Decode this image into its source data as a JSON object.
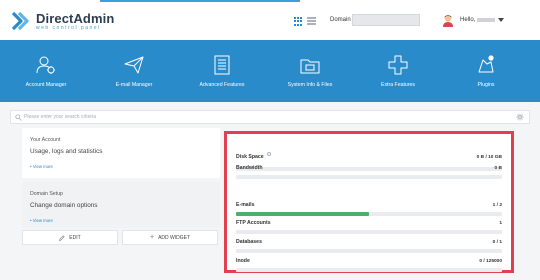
{
  "brand": {
    "title": "DirectAdmin",
    "subtitle": "web control panel",
    "colors": {
      "primary": "#2a8bcb",
      "dark": "#2c3e50",
      "highlight": "#e0414e",
      "progress": "#4caf6a"
    }
  },
  "header": {
    "domain_label": "Domain",
    "hello_label": "Hello,"
  },
  "nav": {
    "items": [
      {
        "label": "Account Manager",
        "icon": "account-manager-icon"
      },
      {
        "label": "E-mail Manager",
        "icon": "email-manager-icon"
      },
      {
        "label": "Advanced Features",
        "icon": "advanced-features-icon"
      },
      {
        "label": "System Info & Files",
        "icon": "system-info-icon"
      },
      {
        "label": "Extra Features",
        "icon": "extra-features-icon"
      },
      {
        "label": "Plugins",
        "icon": "plugins-icon"
      }
    ]
  },
  "search": {
    "placeholder": "Please enter your search criteria"
  },
  "cards": [
    {
      "title": "Your Account",
      "desc": "Usage, logs and statistics",
      "link": "• View more"
    },
    {
      "title": "Domain Setup",
      "desc": "Change domain options",
      "link": "• View more"
    }
  ],
  "actions": {
    "edit_label": "EDIT",
    "add_widget_label": "ADD WIDGET"
  },
  "stats": [
    {
      "label": "Disk Space",
      "value": "0 B / 10 GB",
      "fraction": 0.0,
      "info": true
    },
    {
      "label": "Bandwidth",
      "value": "0 B",
      "fraction": 0.0,
      "info": false
    },
    {
      "label": "E-mails",
      "value": "1 / 2",
      "fraction": 0.5,
      "info": false
    },
    {
      "label": "FTP Accounts",
      "value": "1",
      "fraction": 0.0,
      "info": false
    },
    {
      "label": "Databases",
      "value": "0 / 1",
      "fraction": 0.0,
      "info": false
    },
    {
      "label": "Inode",
      "value": "0 / 125000",
      "fraction": 0.0,
      "info": false
    }
  ]
}
